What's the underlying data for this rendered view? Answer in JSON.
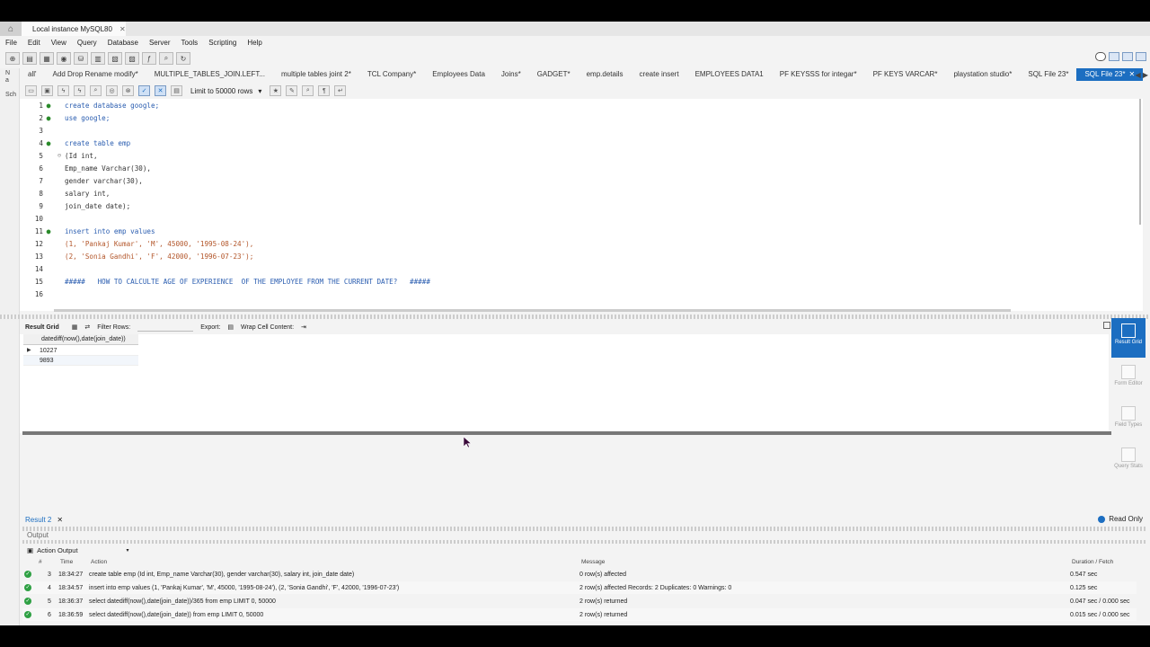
{
  "window": {
    "connection_tab": "Local instance MySQL80",
    "close": "✕"
  },
  "menu": [
    "File",
    "Edit",
    "View",
    "Query",
    "Database",
    "Server",
    "Tools",
    "Scripting",
    "Help"
  ],
  "query_tabs": [
    {
      "label": "all'"
    },
    {
      "label": "Add Drop Rename modify*"
    },
    {
      "label": "MULTIPLE_TABLES_JOIN.LEFT..."
    },
    {
      "label": "multiple tables joint 2*"
    },
    {
      "label": "TCL Company*"
    },
    {
      "label": "Employees Data"
    },
    {
      "label": "Joins*"
    },
    {
      "label": "GADGET*"
    },
    {
      "label": "emp.details"
    },
    {
      "label": "create insert"
    },
    {
      "label": "EMPLOYEES DATA1"
    },
    {
      "label": "PF KEYSSS for integar*"
    },
    {
      "label": "PF KEYS VARCAR*"
    },
    {
      "label": "playstation studio*"
    },
    {
      "label": "SQL File 23*"
    },
    {
      "label": "SQL File 23*",
      "active": true
    }
  ],
  "editor_toolbar": {
    "limit": "Limit to 50000 rows"
  },
  "editor_lines": [
    {
      "n": "1",
      "dot": "●",
      "code": "create database google;"
    },
    {
      "n": "2",
      "dot": "●",
      "code": "use google;"
    },
    {
      "n": "3",
      "dot": "",
      "code": ""
    },
    {
      "n": "4",
      "dot": "●",
      "code": "create table emp"
    },
    {
      "n": "5",
      "dot": "",
      "code": "(Id int,"
    },
    {
      "n": "6",
      "dot": "",
      "code": "Emp_name Varchar(30),"
    },
    {
      "n": "7",
      "dot": "",
      "code": "gender varchar(30),"
    },
    {
      "n": "8",
      "dot": "",
      "code": "salary int,"
    },
    {
      "n": "9",
      "dot": "",
      "code": "join_date date);"
    },
    {
      "n": "10",
      "dot": "",
      "code": ""
    },
    {
      "n": "11",
      "dot": "●",
      "code": "insert into emp values"
    },
    {
      "n": "12",
      "dot": "",
      "code": "(1, 'Pankaj Kumar', 'M', 45000, '1995-08-24'),"
    },
    {
      "n": "13",
      "dot": "",
      "code": "(2, 'Sonia Gandhi', 'F', 42000, '1996-07-23');"
    },
    {
      "n": "14",
      "dot": "",
      "code": ""
    },
    {
      "n": "15",
      "dot": "",
      "code": "#####   HOW TO CALCULTE AGE OF EXPERIENCE  OF THE EMPLOYEE FROM THE CURRENT DATE?   #####"
    },
    {
      "n": "16",
      "dot": "",
      "code": ""
    }
  ],
  "result_toolbar": {
    "result_grid": "Result Grid",
    "filter_rows": "Filter Rows:",
    "export": "Export:",
    "wrap": "Wrap Cell Content:"
  },
  "result_grid": {
    "column": "datediff(now(),date(join_date))",
    "rows": [
      "10227",
      "9893"
    ]
  },
  "right_panel": [
    {
      "label": "Result Grid",
      "active": true
    },
    {
      "label": "Form Editor"
    },
    {
      "label": "Field Types"
    },
    {
      "label": "Query Stats"
    }
  ],
  "result_tab": "Result 2",
  "read_only": "Read Only",
  "output": {
    "label": "Output",
    "selector": "Action Output",
    "headers": {
      "num": "#",
      "time": "Time",
      "action": "Action",
      "message": "Message",
      "duration": "Duration / Fetch"
    },
    "rows": [
      {
        "num": "3",
        "time": "18:34:27",
        "action": "create table emp (Id int, Emp_name Varchar(30), gender varchar(30), salary int, join_date date)",
        "message": "0 row(s) affected",
        "duration": "0.547 sec"
      },
      {
        "num": "4",
        "time": "18:34:57",
        "action": "insert into emp values  (1, 'Pankaj Kumar', 'M', 45000, '1995-08-24'), (2, 'Sonia Gandhi', 'F', 42000, '1996-07-23')",
        "message": "2 row(s) affected Records: 2  Duplicates: 0  Warnings: 0",
        "duration": "0.125 sec"
      },
      {
        "num": "5",
        "time": "18:36:37",
        "action": "select datediff(now(),date(join_date))/365 from emp LIMIT 0, 50000",
        "message": "2 row(s) returned",
        "duration": "0.047 sec / 0.000 sec"
      },
      {
        "num": "6",
        "time": "18:36:59",
        "action": "select datediff(now(),date(join_date)) from emp LIMIT 0, 50000",
        "message": "2 row(s) returned",
        "duration": "0.015 sec / 0.000 sec"
      }
    ]
  }
}
